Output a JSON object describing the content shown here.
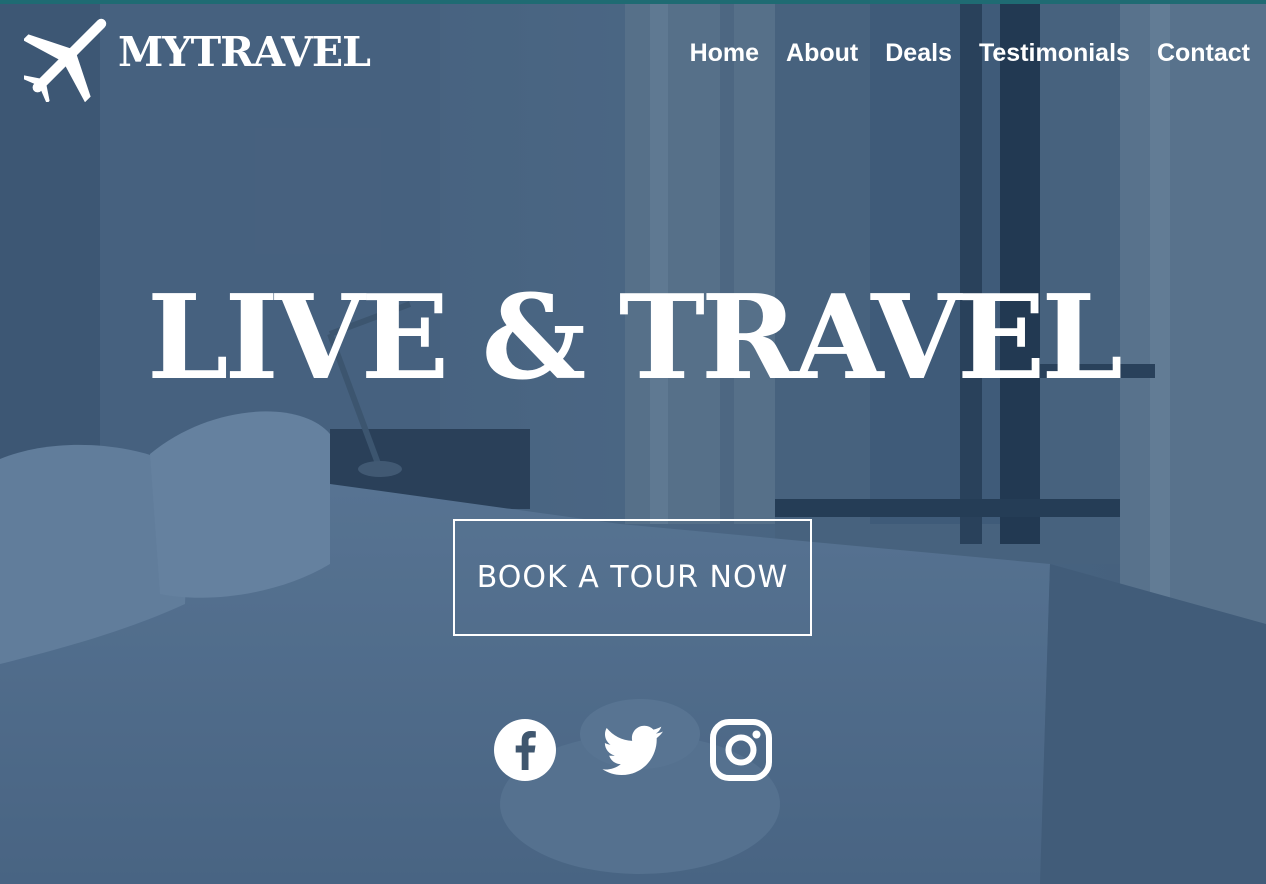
{
  "brand": {
    "name": "MYTRAVEL",
    "icon": "airplane-icon"
  },
  "nav": {
    "items": [
      {
        "label": "Home"
      },
      {
        "label": "About"
      },
      {
        "label": "Deals"
      },
      {
        "label": "Testimonials"
      },
      {
        "label": "Contact"
      }
    ]
  },
  "hero": {
    "title": "LIVE & TRAVEL",
    "cta_label": "BOOK A TOUR NOW"
  },
  "social": [
    {
      "icon": "facebook-icon"
    },
    {
      "icon": "twitter-icon"
    },
    {
      "icon": "instagram-icon"
    }
  ],
  "colors": {
    "top_strip": "#1f6b73",
    "overlay": "#3c556f",
    "text": "#ffffff"
  }
}
